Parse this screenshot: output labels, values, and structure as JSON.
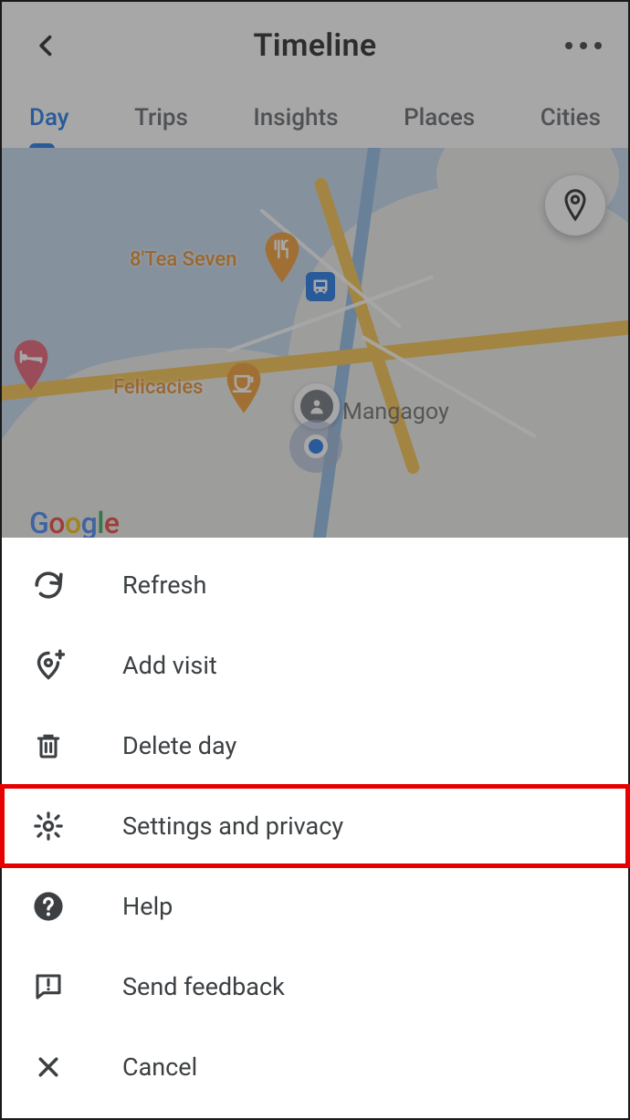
{
  "header": {
    "title": "Timeline"
  },
  "tabs": {
    "items": [
      {
        "label": "Day",
        "active": true
      },
      {
        "label": "Trips",
        "active": false
      },
      {
        "label": "Insights",
        "active": false
      },
      {
        "label": "Places",
        "active": false
      },
      {
        "label": "Cities",
        "active": false
      }
    ]
  },
  "map": {
    "places": {
      "tea": "8'Tea Seven",
      "felicacies": "Felicacies",
      "area": "Mangagoy"
    },
    "branding": {
      "g": "G",
      "o1": "o",
      "o2": "o",
      "g2": "g",
      "l": "l",
      "e": "e"
    }
  },
  "menu": {
    "refresh": "Refresh",
    "add_visit": "Add visit",
    "delete_day": "Delete day",
    "settings": "Settings and privacy",
    "help": "Help",
    "feedback": "Send feedback",
    "cancel": "Cancel"
  }
}
